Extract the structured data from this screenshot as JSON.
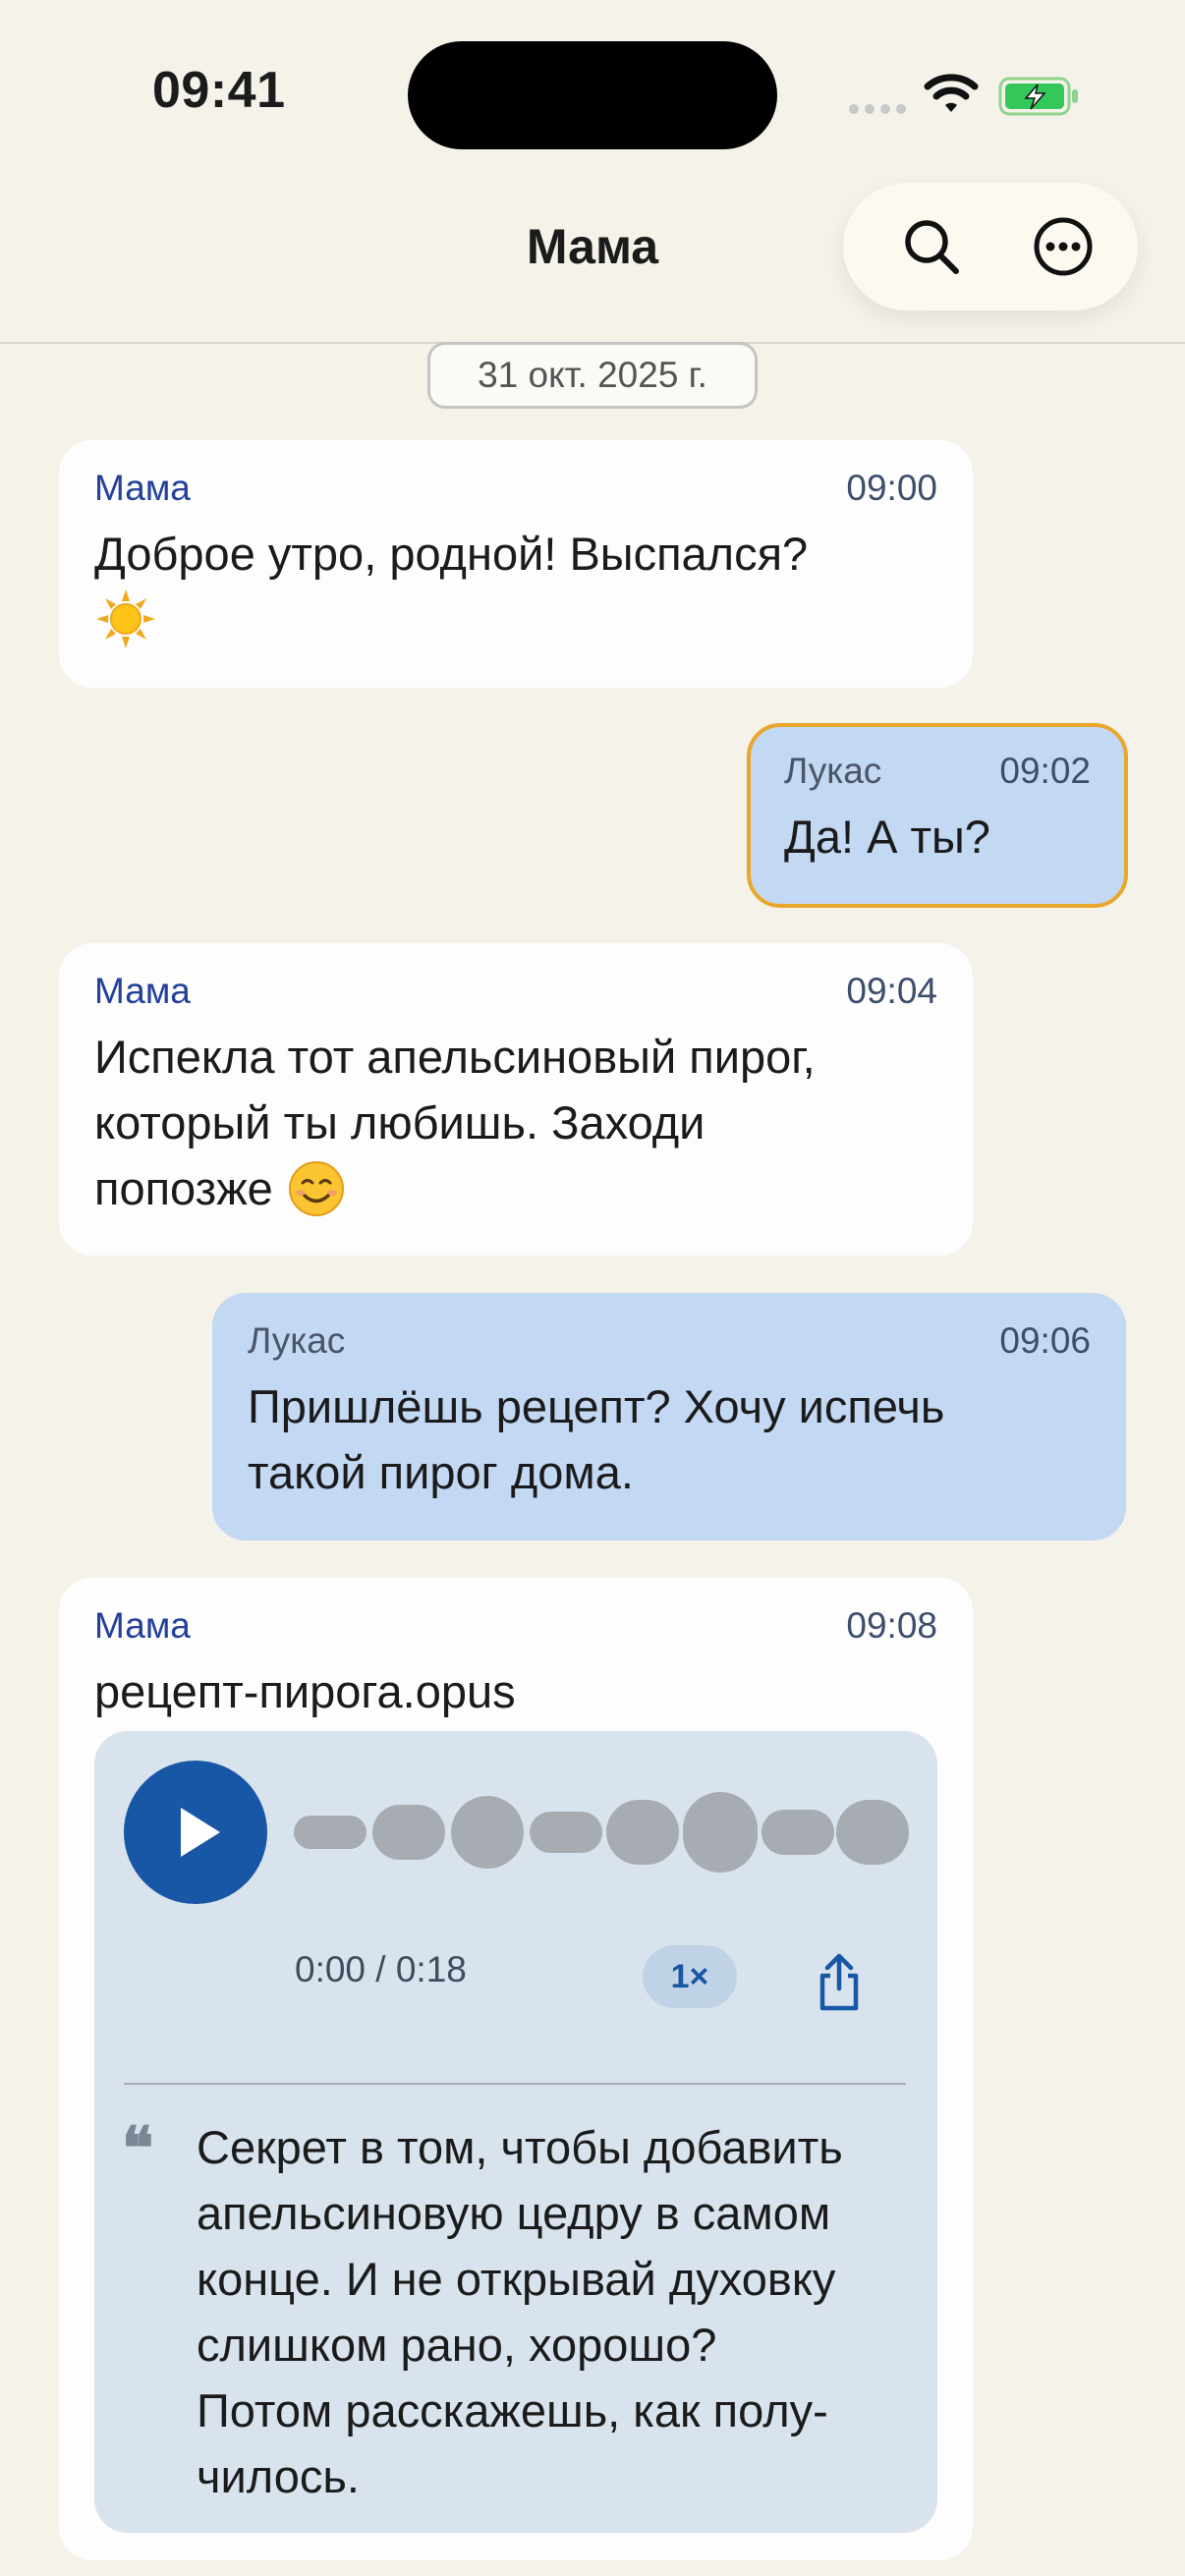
{
  "status_bar": {
    "time": "09:41"
  },
  "header": {
    "title": "Мама"
  },
  "date_label": "31 окт. 2025 г.",
  "messages": [
    {
      "sender": "Мама",
      "time": "09:00",
      "text": "Доброе утро, родной! Выспался?",
      "emoji": "sun"
    },
    {
      "sender": "Лукас",
      "time": "09:02",
      "text": "Да! А ты?"
    },
    {
      "sender": "Мама",
      "time": "09:04",
      "lines": [
        "Испекла тот апельсиновый пирог,",
        "который ты любишь. Заходи",
        "попозже"
      ],
      "emoji": "smiling-face"
    },
    {
      "sender": "Лукас",
      "time": "09:06",
      "lines": [
        "Пришлёшь рецепт? Хочу испечь",
        "такой пирог дома."
      ]
    },
    {
      "sender": "Мама",
      "time": "09:08",
      "file_name": "рецепт-пирога.opus",
      "audio": {
        "progress_label": "0:00 / 0:18",
        "speed_label": "1×",
        "transcript_lines": [
          "Секрет в том, чтобы добавить",
          "апельсиновую цедру в самом",
          "конце. И не открывай духовку",
          "слишком рано, хорошо?",
          "Потом расскажешь, как полу-",
          "чилось."
        ]
      }
    }
  ],
  "colors": {
    "background": "#f5f2ea",
    "incoming_bubble": "#fdfdfd",
    "outgoing_bubble": "#c3d8f3",
    "highlight_border": "#e8a72c",
    "accent": "#1856a6",
    "sender_name": "#23409b"
  }
}
